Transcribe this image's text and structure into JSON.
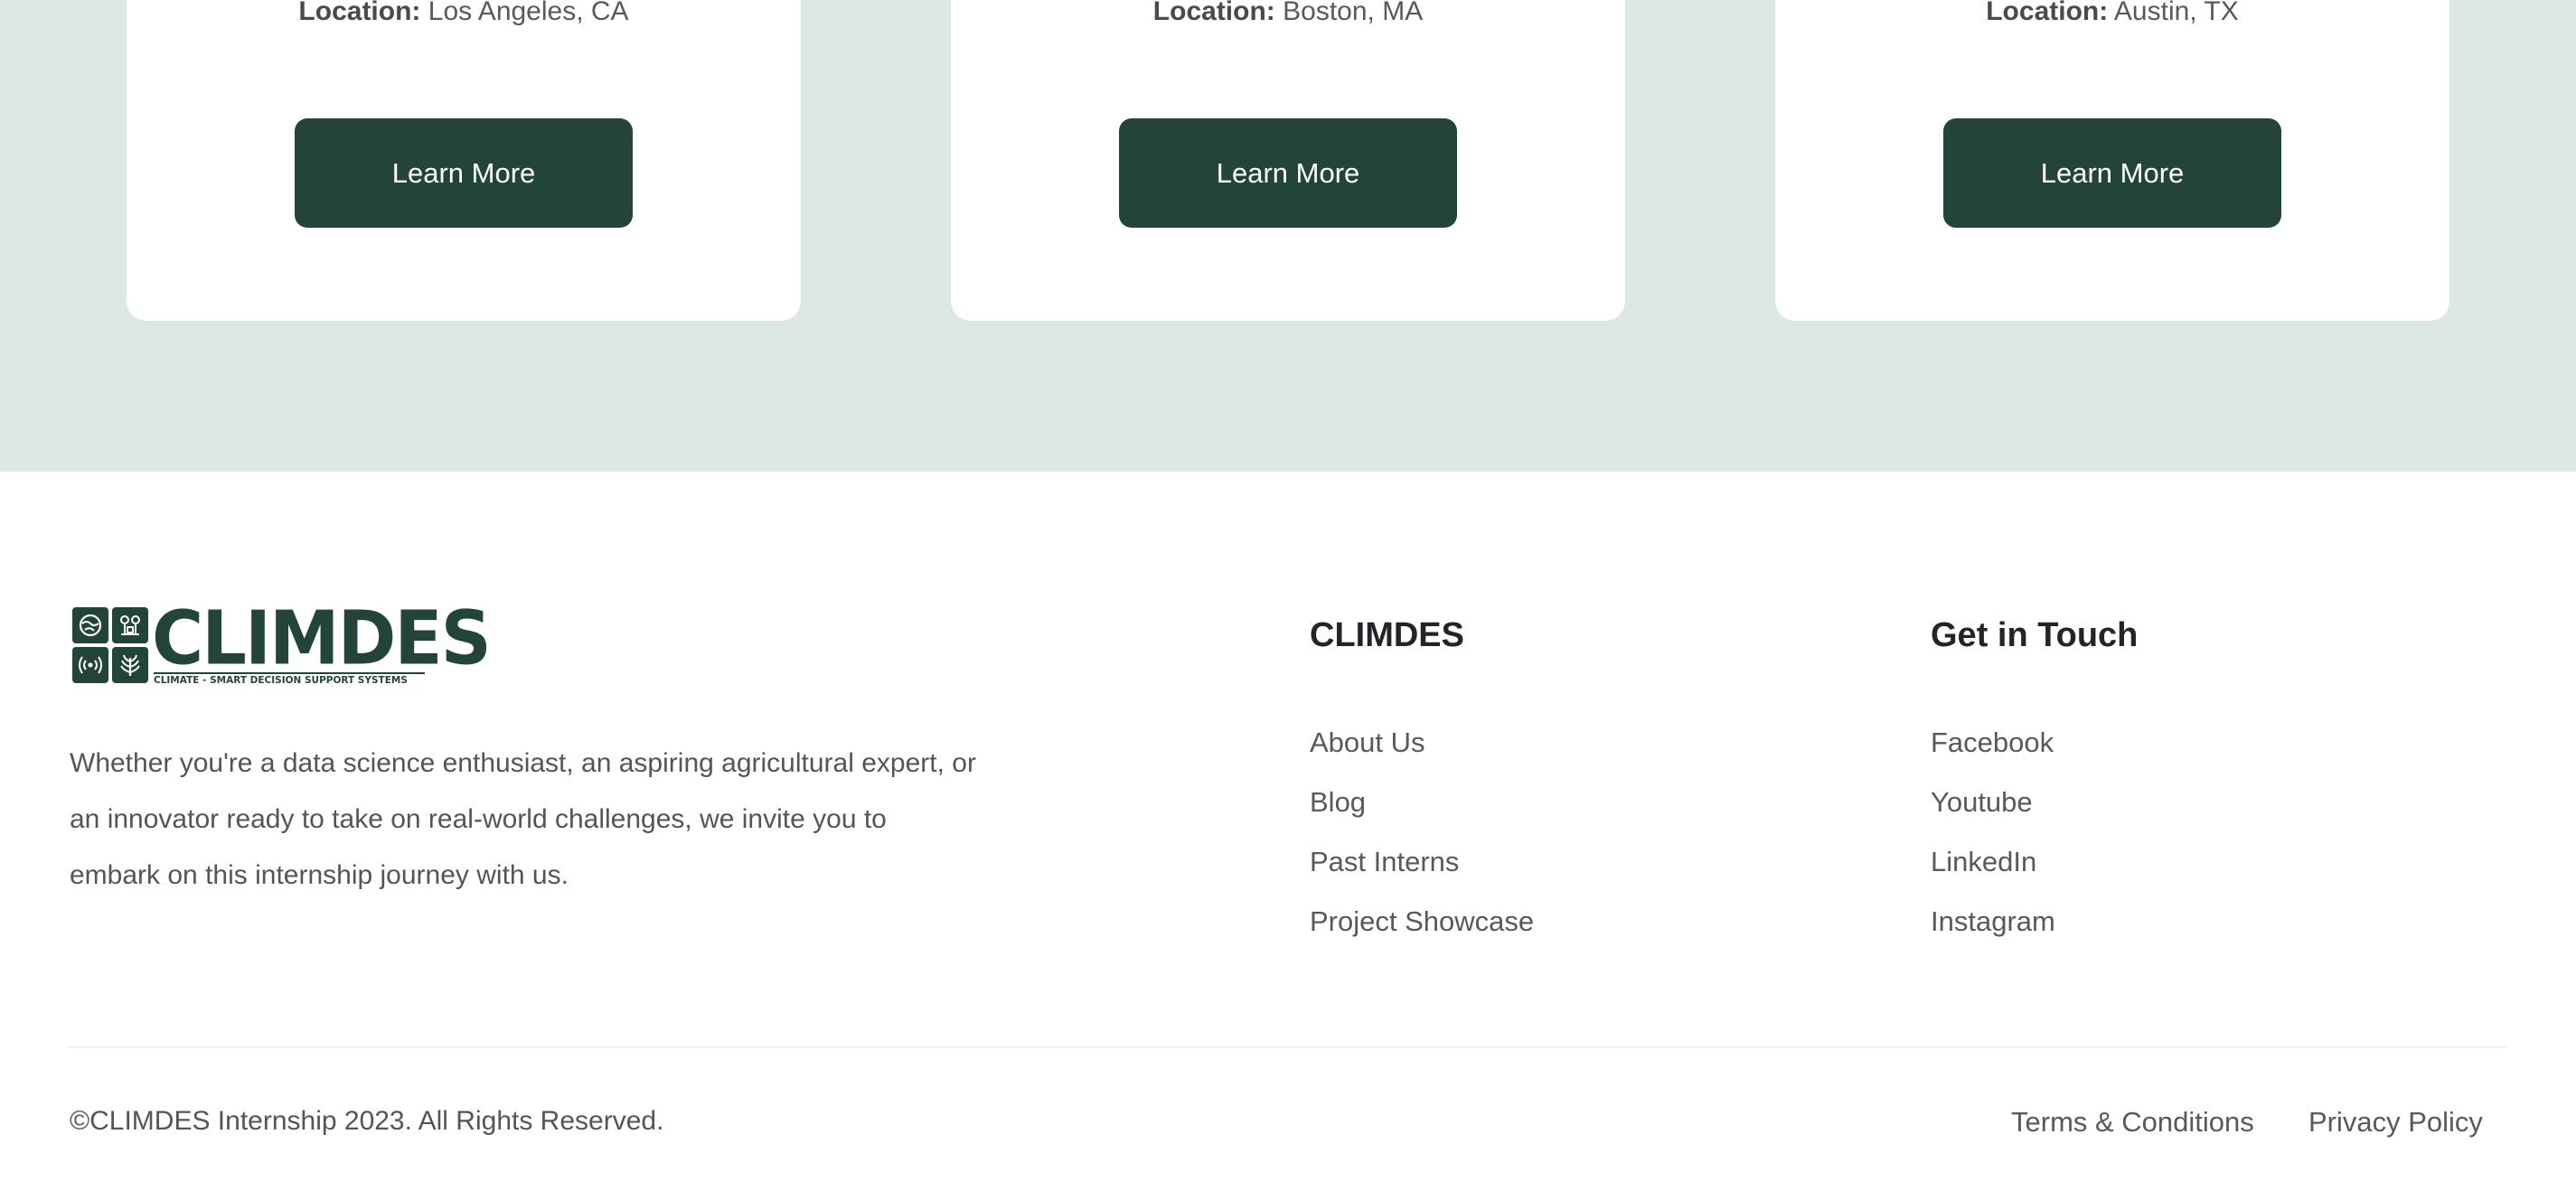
{
  "cards": [
    {
      "location_label": "Location:",
      "location_value": " Los Angeles, CA",
      "button_label": "Learn More"
    },
    {
      "location_label": "Location:",
      "location_value": " Boston, MA",
      "button_label": "Learn More"
    },
    {
      "location_label": "Location:",
      "location_value": " Austin, TX",
      "button_label": "Learn More"
    }
  ],
  "footer": {
    "logo": {
      "wordmark": "CLIMDES",
      "tagline": "CLIMATE - SMART DECISION SUPPORT SYSTEMS",
      "tile_icons": [
        "globe-icon",
        "plant-sprouts-icon",
        "signal-waves-icon",
        "wheat-icon"
      ]
    },
    "description": "Whether you're a data science enthusiast, an aspiring agricultural expert, or an innovator ready to take on real-world challenges, we invite you to embark on this internship journey with us.",
    "columns": [
      {
        "title": "CLIMDES",
        "links": [
          "About Us",
          "Blog",
          "Past Interns",
          "Project Showcase"
        ]
      },
      {
        "title": "Get in Touch",
        "links": [
          "Facebook",
          "Youtube",
          "LinkedIn",
          "Instagram"
        ]
      }
    ],
    "copyright": "©CLIMDES Internship 2023. All Rights Reserved.",
    "legal_links": [
      "Terms & Conditions",
      "Privacy Policy"
    ]
  },
  "colors": {
    "brand_dark_green": "#23443a",
    "section_background": "#dce8e5",
    "card_background": "#ffffff",
    "footer_text": "#555555"
  }
}
